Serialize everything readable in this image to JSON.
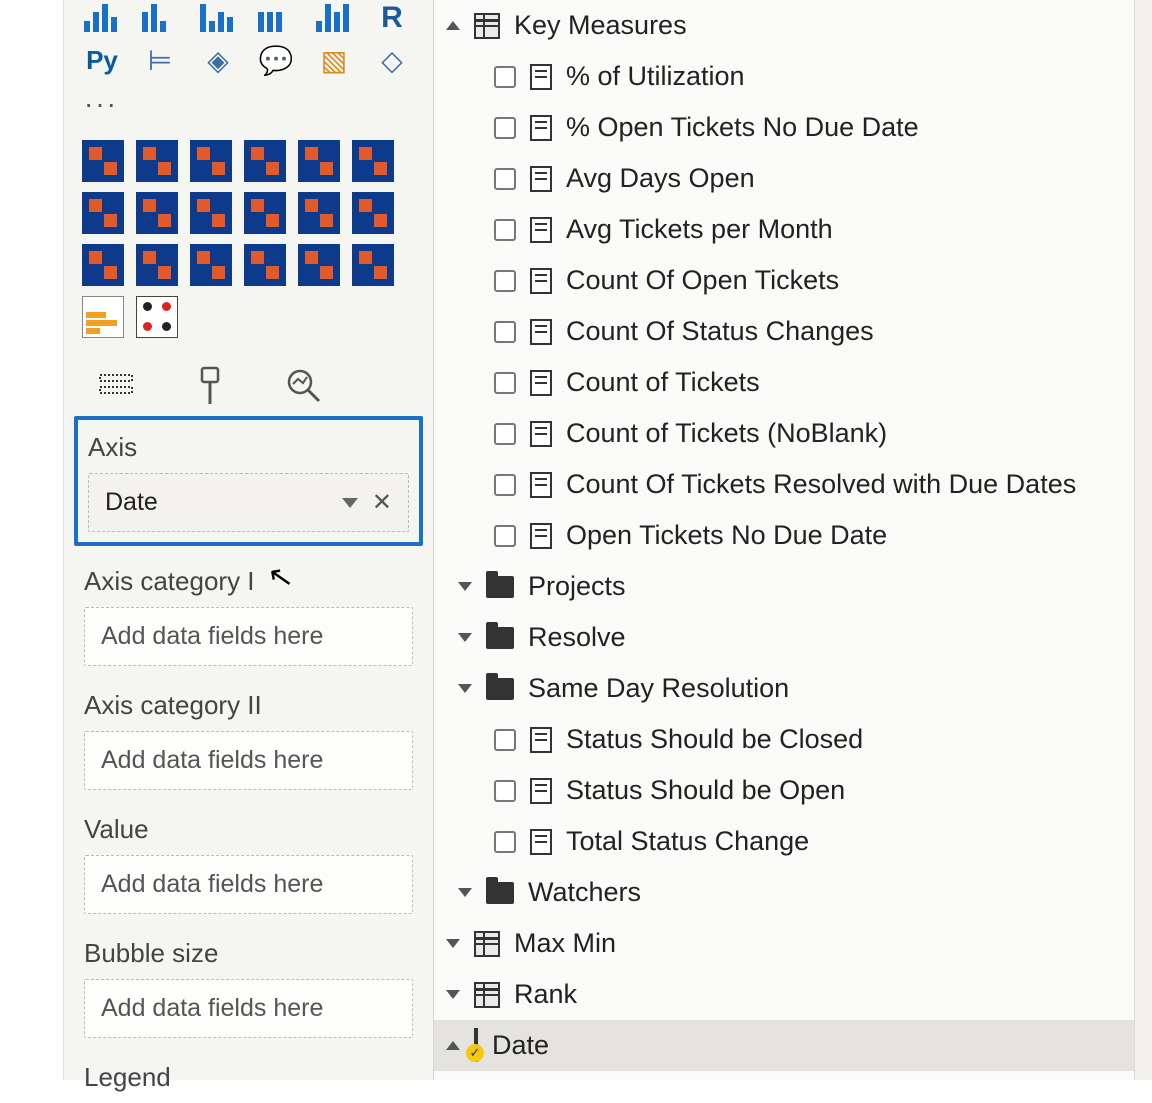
{
  "viz_palette": {
    "py_label": "Py",
    "ellipsis": "···"
  },
  "prop_tabs": {
    "fields_active": true
  },
  "wells": {
    "axis": {
      "label": "Axis",
      "field": "Date"
    },
    "axis_cat1": {
      "label": "Axis category I",
      "placeholder": "Add data fields here"
    },
    "axis_cat2": {
      "label": "Axis category II",
      "placeholder": "Add data fields here"
    },
    "value": {
      "label": "Value",
      "placeholder": "Add data fields here"
    },
    "bubble": {
      "label": "Bubble size",
      "placeholder": "Add data fields here"
    },
    "legend": {
      "label": "Legend"
    }
  },
  "fields": {
    "key_measures": {
      "label": "Key Measures",
      "items": [
        "% of Utilization",
        "% Open Tickets No Due Date",
        "Avg Days Open",
        "Avg Tickets per Month",
        "Count Of Open Tickets",
        "Count Of Status Changes",
        "Count of Tickets",
        "Count of Tickets (NoBlank)",
        "Count Of Tickets Resolved with Due Dates",
        "Open Tickets No Due Date"
      ]
    },
    "folders": [
      "Projects",
      "Resolve",
      "Same Day Resolution"
    ],
    "status_measures": [
      "Status Should be Closed",
      "Status Should be Open",
      "Total Status Change"
    ],
    "watchers_folder": "Watchers",
    "tables": [
      "Max Min",
      "Rank"
    ],
    "date_table": "Date"
  }
}
